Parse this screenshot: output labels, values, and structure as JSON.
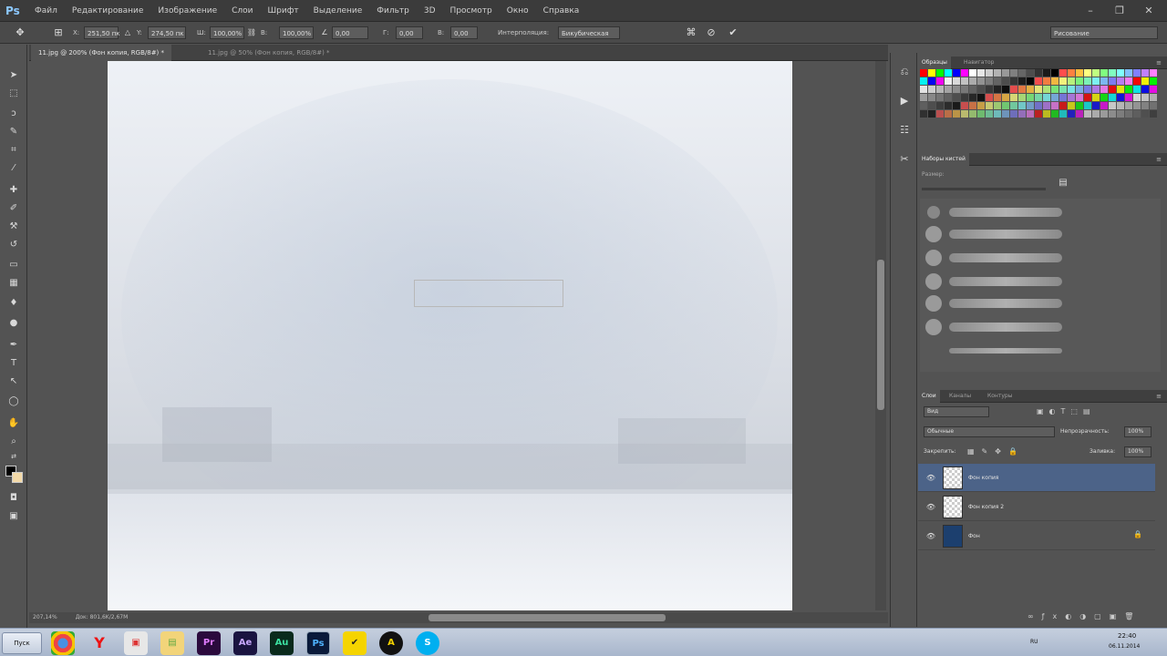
{
  "app": {
    "logo": "Ps"
  },
  "menu": [
    "Файл",
    "Редактирование",
    "Изображение",
    "Слои",
    "Шрифт",
    "Выделение",
    "Фильтр",
    "3D",
    "Просмотр",
    "Окно",
    "Справка"
  ],
  "options": {
    "x_label": "X:",
    "x_value": "251,50 пк",
    "y_label": "Y:",
    "y_value": "274,50 пк",
    "w_label": "Ш:",
    "w_value": "100,00%",
    "h_label": "В:",
    "h_value": "100,00%",
    "angle_value": "0,00",
    "hskew_label": "Г:",
    "hskew_value": "0,00",
    "vskew_label": "В:",
    "vskew_value": "0,00",
    "interp_label": "Интерполяция:",
    "interp_value": "Бикубическая",
    "workspace": "Рисование"
  },
  "tabs": [
    {
      "label": "11.jpg @ 200% (Фон копия, RGB/8#) *",
      "active": true
    },
    {
      "label": "11.jpg @ 50% (Фон копия, RGB/8#) *",
      "active": false
    }
  ],
  "status": {
    "zoom": "207,14%",
    "doc": "Док: 801,6K/2,67M"
  },
  "panels": {
    "swatches_tab": "Образцы",
    "navigator_tab": "Навигатор",
    "brushsets_tab": "Наборы кистей",
    "brush_size_label": "Размер:",
    "layers_tab": "Слои",
    "channels_tab": "Каналы",
    "paths_tab": "Контуры",
    "kind_label": "Вид",
    "blend_mode": "Обычные",
    "opacity_label": "Непрозрачность:",
    "opacity_value": "100%",
    "lock_label": "Закрепить:",
    "fill_label": "Заливка:",
    "fill_value": "100%"
  },
  "layers": [
    {
      "name": "Фон копия",
      "selected": true
    },
    {
      "name": "Фон копия 2",
      "selected": false
    },
    {
      "name": "Фон",
      "selected": false,
      "locked": true
    }
  ],
  "swatch_colors": [
    "#ff0000",
    "#ffff00",
    "#00ff00",
    "#00ffff",
    "#0000ff",
    "#ff00ff",
    "#ffffff",
    "#e6e6e6",
    "#cccccc",
    "#b3b3b3",
    "#999999",
    "#808080",
    "#666666",
    "#4d4d4d",
    "#333333",
    "#1a1a1a",
    "#000000",
    "#ff4d4d",
    "#ff8040",
    "#ffc040",
    "#ffff80",
    "#c0ff80",
    "#80ff80",
    "#80ffc0",
    "#80ffff",
    "#80c0ff",
    "#8080ff",
    "#c080ff",
    "#ff80ff"
  ],
  "taskbar": {
    "start": "Пуск",
    "lang": "RU",
    "time": "22:40",
    "date": "06.11.2014",
    "apps": [
      "Chrome",
      "Yandex",
      "Folder",
      "Explorer",
      "Pr",
      "Ae",
      "Au",
      "Ps",
      "Norton",
      "A",
      "Skype"
    ]
  }
}
